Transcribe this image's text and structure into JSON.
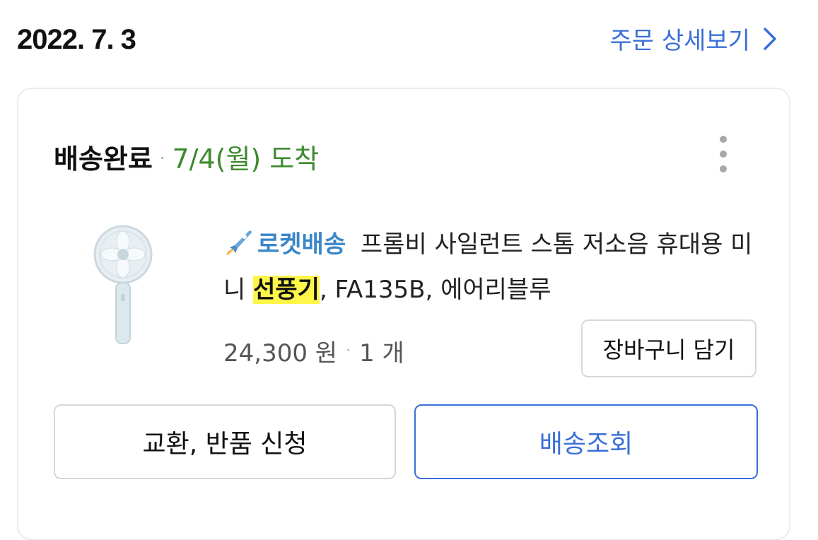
{
  "order": {
    "date": "2022. 7. 3",
    "detail_link_label": "주문 상세보기"
  },
  "shipment": {
    "status": "배송완료",
    "separator": "·",
    "arrival": "7/4(월) 도착"
  },
  "product": {
    "badge_label": "로켓배송",
    "title_before": " 프롬비 사일런트 스톰 저소음 휴대용 미니 ",
    "title_highlight": "선풍기",
    "title_after": ", FA135B, 에어리블루",
    "price": "24,300 원",
    "separator": "·",
    "quantity": "1 개",
    "cart_button_label": "장바구니 담기"
  },
  "actions": {
    "exchange_label": "교환, 반품 신청",
    "tracking_label": "배송조회"
  },
  "colors": {
    "link_blue": "#3a6fd8",
    "arrival_green": "#3d8a2e",
    "rocket_blue": "#3a86c8",
    "highlight_yellow": "#fff64a"
  },
  "icons": {
    "detail_link": "chevron-right-icon",
    "menu": "more-vertical-icon",
    "badge": "rocket-icon"
  }
}
